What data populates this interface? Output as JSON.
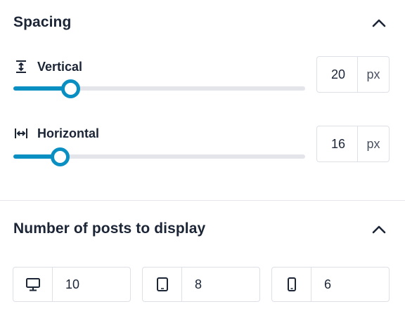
{
  "spacing": {
    "title": "Spacing",
    "vertical": {
      "label": "Vertical",
      "icon": "vertical-spacing-icon",
      "value": "20",
      "unit": "px",
      "slider_fraction": 0.195
    },
    "horizontal": {
      "label": "Horizontal",
      "icon": "horizontal-spacing-icon",
      "value": "16",
      "unit": "px",
      "slider_fraction": 0.16
    }
  },
  "posts": {
    "title": "Number of posts to display",
    "devices": [
      {
        "icon": "desktop-icon",
        "value": "10"
      },
      {
        "icon": "tablet-icon",
        "value": "8"
      },
      {
        "icon": "mobile-icon",
        "value": "6"
      }
    ]
  },
  "colors": {
    "accent": "#0a8fc2",
    "track": "#e3e5ea",
    "text": "#1b2536",
    "border": "#dde0e6"
  }
}
